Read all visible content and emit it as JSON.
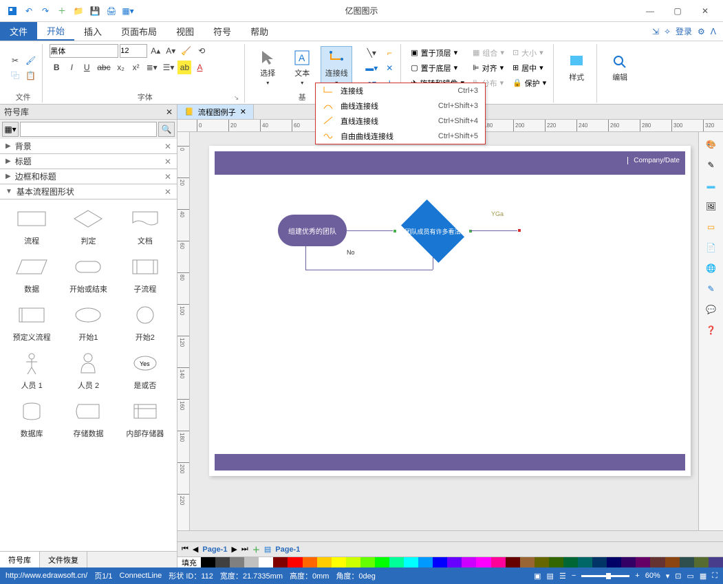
{
  "app": {
    "title": "亿图图示"
  },
  "menubar": {
    "file": "文件",
    "items": [
      "开始",
      "插入",
      "页面布局",
      "视图",
      "符号",
      "帮助"
    ],
    "login": "登录"
  },
  "ribbon": {
    "groups": {
      "file": "文件",
      "font": "字体",
      "font_name": "黑体",
      "font_size": "12",
      "select": "选择",
      "text": "文本",
      "connect": "连接线",
      "base": "基",
      "top": "置于顶层",
      "bottom": "置于底层",
      "rotate": "旋转和镜像",
      "group": "组合",
      "align": "对齐",
      "distribute": "分布",
      "size": "大小",
      "center": "居中",
      "protect": "保护",
      "style": "样式",
      "edit": "编辑"
    }
  },
  "dropdown": {
    "items": [
      {
        "label": "连接线",
        "shortcut": "Ctrl+3"
      },
      {
        "label": "曲线连接线",
        "shortcut": "Ctrl+Shift+3"
      },
      {
        "label": "直线连接线",
        "shortcut": "Ctrl+Shift+4"
      },
      {
        "label": "自由曲线连接线",
        "shortcut": "Ctrl+Shift+5"
      }
    ]
  },
  "left_panel": {
    "title": "符号库",
    "accordions": [
      "背景",
      "标题",
      "边框和标题",
      "基本流程图形状"
    ],
    "shapes": [
      "流程",
      "判定",
      "文档",
      "数据",
      "开始或结束",
      "子流程",
      "预定义流程",
      "开始1",
      "开始2",
      "人员 1",
      "人员 2",
      "是或否",
      "数据库",
      "存储数据",
      "内部存储器"
    ],
    "tabs": [
      "符号库",
      "文件恢复"
    ]
  },
  "doc_tab": "流程图例子",
  "canvas": {
    "company": "Company/Date",
    "node_start": "组建优秀的团队",
    "node_decision": "团队成员有许多看法",
    "yes": "YGa",
    "no": "No"
  },
  "page_bar": {
    "page_left": "Page-1",
    "page_main": "Page-1"
  },
  "color_bar_label": "填充",
  "colors": [
    "#000000",
    "#404040",
    "#808080",
    "#c0c0c0",
    "#ffffff",
    "#800000",
    "#ff0000",
    "#ff6600",
    "#ffcc00",
    "#ffff00",
    "#ccff00",
    "#66ff00",
    "#00ff00",
    "#00ff99",
    "#00ffff",
    "#0099ff",
    "#0000ff",
    "#6600ff",
    "#cc00ff",
    "#ff00ff",
    "#ff0099",
    "#660000",
    "#996633",
    "#666600",
    "#336600",
    "#006633",
    "#006666",
    "#003366",
    "#000066",
    "#330066",
    "#660066",
    "#663333",
    "#8B4513",
    "#2F4F4F",
    "#556B2F",
    "#483D8B"
  ],
  "status": {
    "url": "http://www.edrawsoft.cn/",
    "page": "页1/1",
    "tool": "ConnectLine",
    "shape": "形状 ID：112",
    "width": "宽度：21.7335mm",
    "height": "高度：0mm",
    "angle": "角度：0deg",
    "zoom": "60%"
  }
}
